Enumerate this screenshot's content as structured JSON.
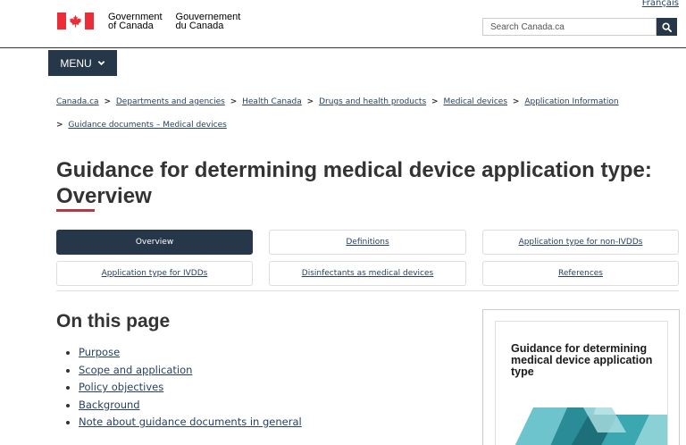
{
  "header": {
    "language_link": "Français",
    "wordmark_en_1": "Government",
    "wordmark_en_2": "of Canada",
    "wordmark_fr_1": "Gouvernement",
    "wordmark_fr_2": "du Canada",
    "search_placeholder": "Search Canada.ca"
  },
  "menu": {
    "label": "MENU"
  },
  "breadcrumb": [
    "Canada.ca",
    "Departments and agencies",
    "Health Canada",
    "Drugs and health products",
    "Medical devices",
    "Application Information",
    "Guidance documents – Medical devices"
  ],
  "page": {
    "title": "Guidance for determining medical device application type: Overview"
  },
  "tabs": [
    {
      "label": "Overview",
      "active": true
    },
    {
      "label": "Definitions",
      "active": false
    },
    {
      "label": "Application type for non-IVDDs",
      "active": false
    },
    {
      "label": "Application type for IVDDs",
      "active": false
    },
    {
      "label": "Disinfectants as medical devices",
      "active": false
    },
    {
      "label": "References",
      "active": false
    }
  ],
  "toc": {
    "title": "On this page",
    "items": [
      "Purpose",
      "Scope and application",
      "Policy objectives",
      "Background",
      "Note about guidance documents in general"
    ]
  },
  "cover": {
    "title": "Guidance for determining medical device application type"
  },
  "colors": {
    "brand_navy": "#26374a",
    "link": "#284162",
    "flag_red": "#eb2d37",
    "accent_red": "#af3c43"
  }
}
